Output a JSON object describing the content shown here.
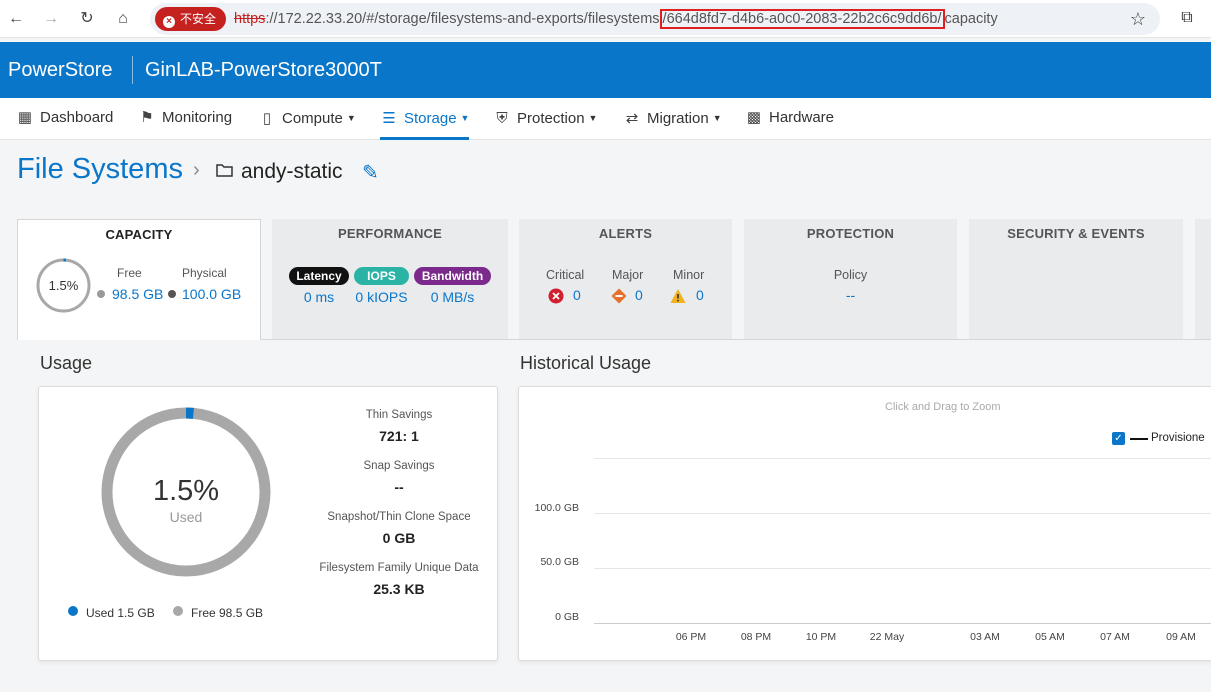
{
  "browser": {
    "security_label": "不安全",
    "url_scheme": "https",
    "url_mid": "://172.22.33.20/#/storage/filesystems-and-exports/filesystems",
    "url_highlight": "/664d8fd7-d4b6-a0c0-2083-22b2c6c9dd6b/",
    "url_tail": "capacity"
  },
  "header": {
    "brand": "PowerStore",
    "system_name": "GinLAB-PowerStore3000T",
    "color": "#0a76c9"
  },
  "nav": {
    "dashboard": "Dashboard",
    "monitoring": "Monitoring",
    "compute": "Compute",
    "storage": "Storage",
    "protection": "Protection",
    "migration": "Migration",
    "hardware": "Hardware"
  },
  "breadcrumb": {
    "root": "File Systems",
    "current": "andy-static"
  },
  "tabs": {
    "capacity": {
      "title": "CAPACITY",
      "percent": "1.5%",
      "percent_value": 1.5,
      "free_label": "Free",
      "free_value": "98.5 GB",
      "physical_label": "Physical",
      "physical_value": "100.0 GB"
    },
    "performance": {
      "title": "PERFORMANCE",
      "latency_label": "Latency",
      "latency_value": "0 ms",
      "iops_label": "IOPS",
      "iops_value": "0 kIOPS",
      "bandwidth_label": "Bandwidth",
      "bandwidth_value": "0 MB/s"
    },
    "alerts": {
      "title": "ALERTS",
      "critical_label": "Critical",
      "critical_value": "0",
      "major_label": "Major",
      "major_value": "0",
      "minor_label": "Minor",
      "minor_value": "0"
    },
    "protection": {
      "title": "PROTECTION",
      "policy_label": "Policy",
      "policy_value": "--"
    },
    "security": {
      "title": "SECURITY & EVENTS"
    }
  },
  "usage": {
    "title": "Usage",
    "percent": "1.5%",
    "percent_value": 1.5,
    "used_label": "Used",
    "thin_savings_label": "Thin Savings",
    "thin_savings_value": "721: 1",
    "snap_savings_label": "Snap Savings",
    "snap_savings_value": "--",
    "snapshot_label": "Snapshot/Thin Clone Space",
    "snapshot_value": "0 GB",
    "unique_label": "Filesystem Family Unique Data",
    "unique_value": "25.3 KB",
    "legend_used": "Used 1.5 GB",
    "legend_free": "Free 98.5 GB",
    "used_color": "#0a76c9",
    "free_color": "#a8a8a8"
  },
  "historical": {
    "title": "Historical Usage",
    "zoom_hint": "Click and Drag to Zoom",
    "series_name": "Provisione",
    "y_ticks": [
      "100.0 GB",
      "50.0 GB",
      "0 GB"
    ],
    "x_ticks": [
      "06 PM",
      "08 PM",
      "10 PM",
      "22 May",
      "03 AM",
      "05 AM",
      "07 AM",
      "09 AM"
    ]
  }
}
